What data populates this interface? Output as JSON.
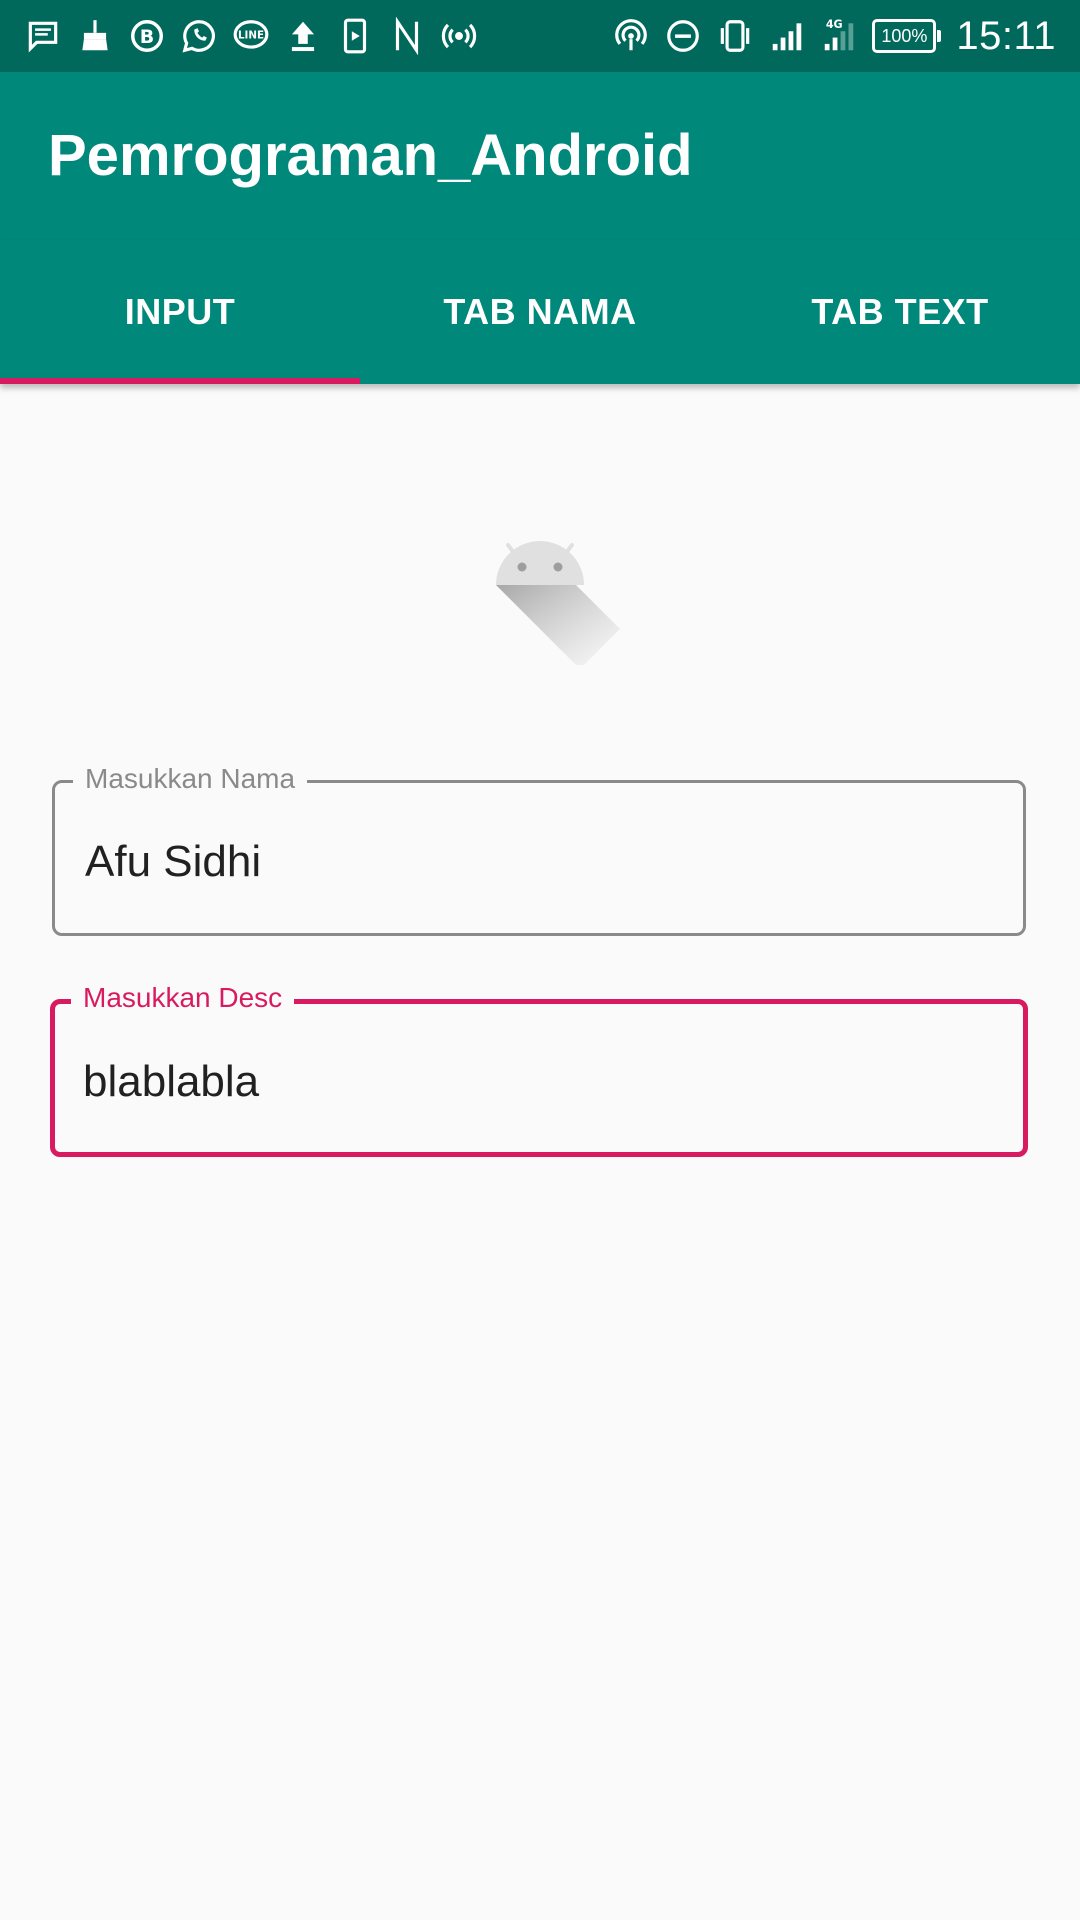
{
  "status_bar": {
    "left_icons": [
      "message-icon",
      "broom-icon",
      "bbm-icon",
      "whatsapp-icon",
      "line-icon",
      "upload-icon",
      "media-icon",
      "n-icon",
      "hotspot-icon"
    ],
    "right_icons": [
      "nfc-icon",
      "dnd-icon",
      "vibrate-icon",
      "signal-icon",
      "signal-4g-icon"
    ],
    "network": "4G",
    "battery": "100%",
    "time": "15:11"
  },
  "app_bar": {
    "title": "Pemrograman_Android"
  },
  "tabs": [
    {
      "label": "INPUT",
      "selected": true
    },
    {
      "label": "TAB NAMA",
      "selected": false
    },
    {
      "label": "TAB TEXT",
      "selected": false
    }
  ],
  "form": {
    "name_field": {
      "label": "Masukkan Nama",
      "value": "Afu Sidhi"
    },
    "desc_field": {
      "label": "Masukkan Desc",
      "value": "blablabla"
    }
  },
  "colors": {
    "primary": "#00897b",
    "primary_dark": "#00695c",
    "accent": "#d81b60",
    "background": "#fafafa"
  }
}
